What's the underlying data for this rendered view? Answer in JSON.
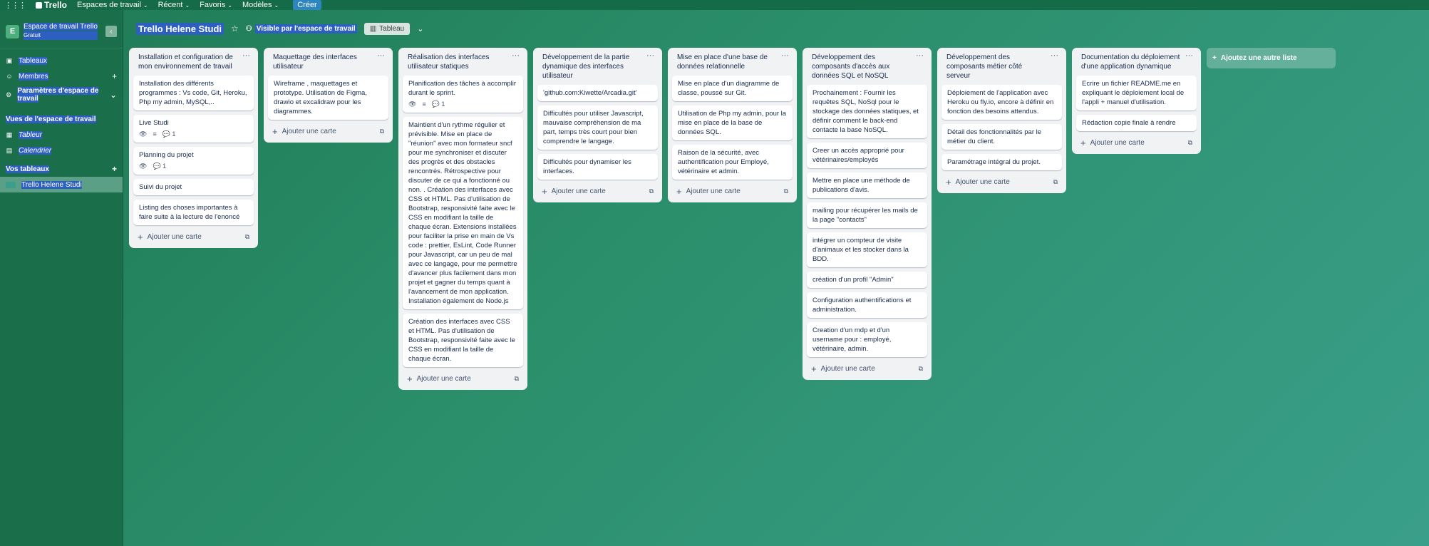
{
  "topnav": {
    "logo": "Trello",
    "menus": [
      "Espaces de travail",
      "Récent",
      "Favoris",
      "Modèles"
    ],
    "create": "Créer"
  },
  "sidebar": {
    "workspace_initial": "E",
    "workspace_name": "Espace de travail Trello",
    "workspace_plan": "Gratuit",
    "items": [
      {
        "label": "Tableaux",
        "icon": "board-icon"
      },
      {
        "label": "Membres",
        "icon": "person-icon"
      },
      {
        "label": "Paramètres d'espace de travail",
        "icon": "gear-icon"
      }
    ],
    "views_title": "Vues de l'espace de travail",
    "views": [
      {
        "label": "Tableur",
        "icon": "table-icon"
      },
      {
        "label": "Calendrier",
        "icon": "calendar-icon"
      }
    ],
    "boards_title": "Vos tableaux",
    "boards": [
      {
        "label": "Trello Helene Studi"
      }
    ]
  },
  "header": {
    "board_title": "Trello Helene Studi",
    "visibility": "Visible par l'espace de travail",
    "view": "Tableau"
  },
  "lists": [
    {
      "title": "Installation et configuration de mon environnement de travail",
      "cards": [
        {
          "text": "Installation des différents programmes : Vs code, Git, Heroku, Php my admin, MySQL,..",
          "badges": []
        },
        {
          "text": "Live Studi",
          "badges": [
            "👁",
            "≡",
            "💬 1"
          ]
        },
        {
          "text": "Planning du projet",
          "badges": [
            "👁",
            "💬 1"
          ]
        },
        {
          "text": "Suivi du projet",
          "badges": []
        },
        {
          "text": "Listing des choses importantes à faire suite à la lecture de l'enoncé",
          "badges": []
        }
      ],
      "add": "Ajouter une carte"
    },
    {
      "title": "Maquettage des interfaces utilisateur",
      "cards": [
        {
          "text": "Wireframe , maquettages et prototype. Utilisation de Figma, drawio et excalidraw pour les diagrammes.",
          "badges": []
        }
      ],
      "add": "Ajouter une carte"
    },
    {
      "title": "Réalisation des interfaces utilisateur statiques",
      "cards": [
        {
          "text": "Planification des tâches à accomplir durant le sprint.",
          "badges": [
            "👁",
            "≡",
            "💬 1"
          ]
        },
        {
          "text": "Maintient d'un rythme régulier et prévisible. Mise en place de \"réunion\" avec mon formateur sncf pour me synchroniser et discuter des progrès et des obstacles rencontrés. Rétrospective pour discuter de ce qui a fonctionné ou non. . Création des interfaces avec CSS et HTML. Pas d'utilisation de Bootstrap, responsivité faite avec le CSS en modifiant la taille de chaque écran. Extensions installées pour faciliter la prise en main de Vs code : prettier, EsLint, Code Runner pour Javascript, car un peu de mal avec ce langage, pour me permettre d'avancer plus facilement dans mon projet et gagner du temps quant à l'avancement de mon application. Installation également de Node.js",
          "badges": []
        },
        {
          "text": "Création des interfaces avec CSS et HTML. Pas d'utilisation de Bootstrap, responsivité faite avec le CSS en modifiant la taille de chaque écran.",
          "badges": []
        }
      ],
      "add": "Ajouter une carte"
    },
    {
      "title": "Développement de la partie dynamique des interfaces utilisateur",
      "cards": [
        {
          "text": "'github.com:Kiwette/Arcadia.git'",
          "badges": []
        },
        {
          "text": "Difficultés pour utiliser Javascript, mauvaise compréhension de ma part, temps très court pour bien comprendre le langage.",
          "badges": []
        },
        {
          "text": "Difficultés pour dynamiser les interfaces.",
          "badges": []
        }
      ],
      "add": "Ajouter une carte"
    },
    {
      "title": "Mise en place d'une base de données relationnelle",
      "cards": [
        {
          "text": "Mise en place d'un diagramme de classe, poussé sur Git.",
          "badges": []
        },
        {
          "text": "Utilisation de Php my admin, pour la mise en place de la base de données SQL.",
          "badges": []
        },
        {
          "text": "Raison de la sécurité, avec authentification pour Employé, vétérinaire et admin.",
          "badges": []
        }
      ],
      "add": "Ajouter une carte"
    },
    {
      "title": "Développement des composants d'accès aux données SQL et NoSQL",
      "cards": [
        {
          "text": "Prochainement : Fournir les requêtes SQL, NoSql pour le stockage des données statiques, et définir comment le back-end contacte la base NoSQL.",
          "badges": []
        },
        {
          "text": "Creer un accès approprié pour vétérinaires/employés",
          "badges": []
        },
        {
          "text": "Mettre en place une méthode de publications d'avis.",
          "badges": []
        },
        {
          "text": "mailing pour récupérer les mails de la page \"contacts\"",
          "badges": []
        },
        {
          "text": "intégrer un compteur de visite d'animaux et les stocker dans la BDD.",
          "badges": []
        },
        {
          "text": "création d'un profil \"Admin\"",
          "badges": []
        },
        {
          "text": "Configuration authentifications et administration.",
          "badges": []
        },
        {
          "text": "Creation d'un mdp et d'un username pour : employé, vétérinaire, admin.",
          "badges": []
        }
      ],
      "add": "Ajouter une carte"
    },
    {
      "title": "Développement des composants métier côté serveur",
      "cards": [
        {
          "text": "Déploiement de l'application avec Heroku ou fly.io, encore à définir en fonction des besoins attendus.",
          "badges": []
        },
        {
          "text": "Détail des fonctionnalités par le métier du client.",
          "badges": []
        },
        {
          "text": "Paramétrage intégral du projet.",
          "badges": []
        }
      ],
      "add": "Ajouter une carte"
    },
    {
      "title": "Documentation du déploiement d'une application dynamique",
      "cards": [
        {
          "text": "Ecrire un fichier README.me en expliquant le déploiement local de l'appli + manuel d'utilisation.",
          "badges": []
        },
        {
          "text": "Rédaction copie finale à rendre",
          "badges": []
        }
      ],
      "add": "Ajouter une carte"
    }
  ],
  "add_list": "Ajoutez une autre liste",
  "colors": {
    "topbar": "#156b47",
    "sidebar": "#1b6e4a",
    "list_bg": "#f1f2f4",
    "highlight": "#2d5fc0"
  }
}
